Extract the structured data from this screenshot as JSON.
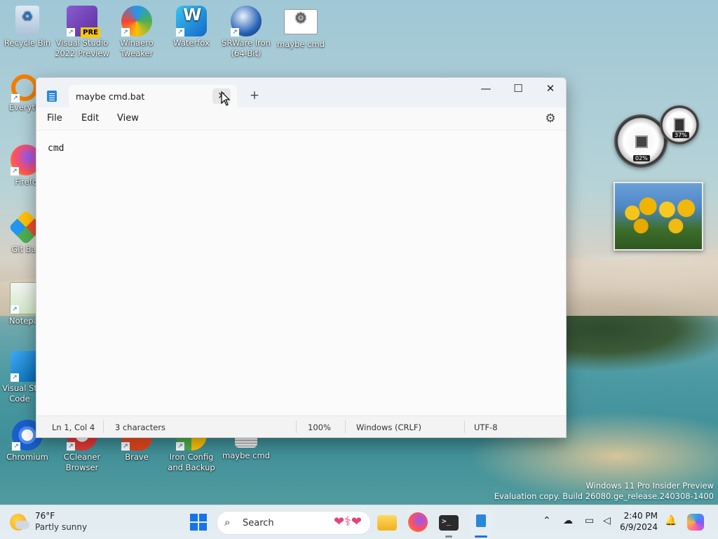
{
  "desktop": {
    "icons": [
      {
        "label": "Recycle Bin"
      },
      {
        "label": "Visual Studio 2022 Preview",
        "badge": "PRE"
      },
      {
        "label": "Winaero Tweaker"
      },
      {
        "label": "Waterfox"
      },
      {
        "label": "SRWare Iron (64-Bit)"
      },
      {
        "label": "maybe cmd"
      },
      {
        "label": "Everyth"
      },
      {
        "label": "Firefo"
      },
      {
        "label": "Git Bas"
      },
      {
        "label": "Notepac"
      },
      {
        "label": "Visual St Code"
      },
      {
        "label": "Chromium"
      },
      {
        "label": "CCleaner Browser"
      },
      {
        "label": "Brave"
      },
      {
        "label": "Iron Config and Backup"
      },
      {
        "label": "maybe cmd"
      }
    ],
    "gadgets": {
      "cpu_meter": {
        "cpu_percent": "02%",
        "memory_percent": "37%"
      }
    },
    "watermark": {
      "line1": "Windows 11 Pro Insider Preview",
      "line2": "Evaluation copy. Build 26080.ge_release.240308-1400"
    }
  },
  "notepad": {
    "tab_title": "maybe cmd.bat",
    "tab_close": "✕",
    "new_tab": "+",
    "window_controls": {
      "minimize": "—",
      "maximize": "☐",
      "close": "✕"
    },
    "menu": {
      "file": "File",
      "edit": "Edit",
      "view": "View"
    },
    "content": "cmd",
    "status": {
      "position": "Ln 1, Col 4",
      "characters": "3 characters",
      "zoom": "100%",
      "line_ending": "Windows (CRLF)",
      "encoding": "UTF-8"
    }
  },
  "taskbar": {
    "weather": {
      "temp": "76°F",
      "desc": "Partly sunny"
    },
    "search": {
      "label": "Search"
    },
    "clock": {
      "time": "2:40 PM",
      "date": "6/9/2024"
    }
  },
  "colors": {
    "accent": "#1a73e8",
    "notepad_icon": "#2b88d8"
  }
}
